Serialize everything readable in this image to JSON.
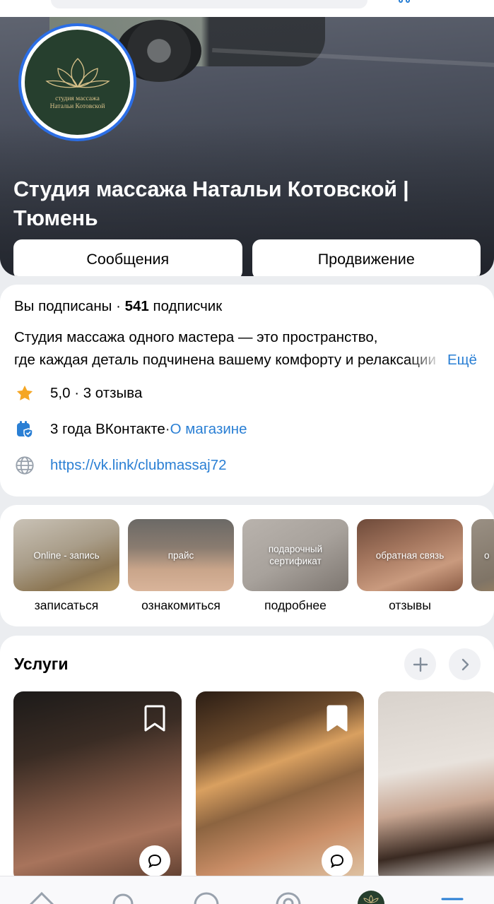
{
  "header": {
    "community_name": "Студия массажа Натальи Котовской | Тюмень",
    "logo_text": [
      "студия массажа",
      "Натальи Котовской"
    ],
    "buttons": {
      "messages": "Сообщения",
      "promotion": "Продвижение"
    }
  },
  "info": {
    "subscribed": "Вы подписаны",
    "dot": " · ",
    "subscriber_count": "541",
    "subscriber_word": " подписчик",
    "description_line1": "Студия массажа одного мастера — это пространство,",
    "description_line2": "где каждая деталь подчинена вашему комфорту и релаксации",
    "more": "Ещё",
    "rating": "5,0 · 3 отзыва",
    "age": "3 года ВКонтакте",
    "age_sep": " · ",
    "about_shop": "О магазине",
    "website": "https://vk.link/clubmassaj72"
  },
  "stories": [
    {
      "caption": "Online - запись",
      "label": "записаться"
    },
    {
      "caption": "прайс",
      "label": "ознакомиться"
    },
    {
      "caption": "подарочный сертификат",
      "label": "подробнее"
    },
    {
      "caption": "обратная связь",
      "label": "отзывы"
    },
    {
      "caption": "о",
      "label": ""
    }
  ],
  "services": {
    "title": "Услуги"
  },
  "icons": {
    "rating": "star-icon",
    "age": "calendar-shield-icon",
    "website": "globe-icon",
    "add": "plus-icon",
    "next": "chevron-right-icon",
    "bookmark": "bookmark-icon",
    "comment": "comment-bubble-icon",
    "nav": [
      "home-icon",
      "search-icon",
      "messenger-icon",
      "services-icon",
      "community-avatar",
      "menu-icon"
    ]
  },
  "colors": {
    "accent": "#2a7fd4",
    "avatar_ring": "#2b6ee6",
    "star": "#f5a623",
    "logo_bg": "#263f2e",
    "logo_gold": "#d9c28a"
  }
}
